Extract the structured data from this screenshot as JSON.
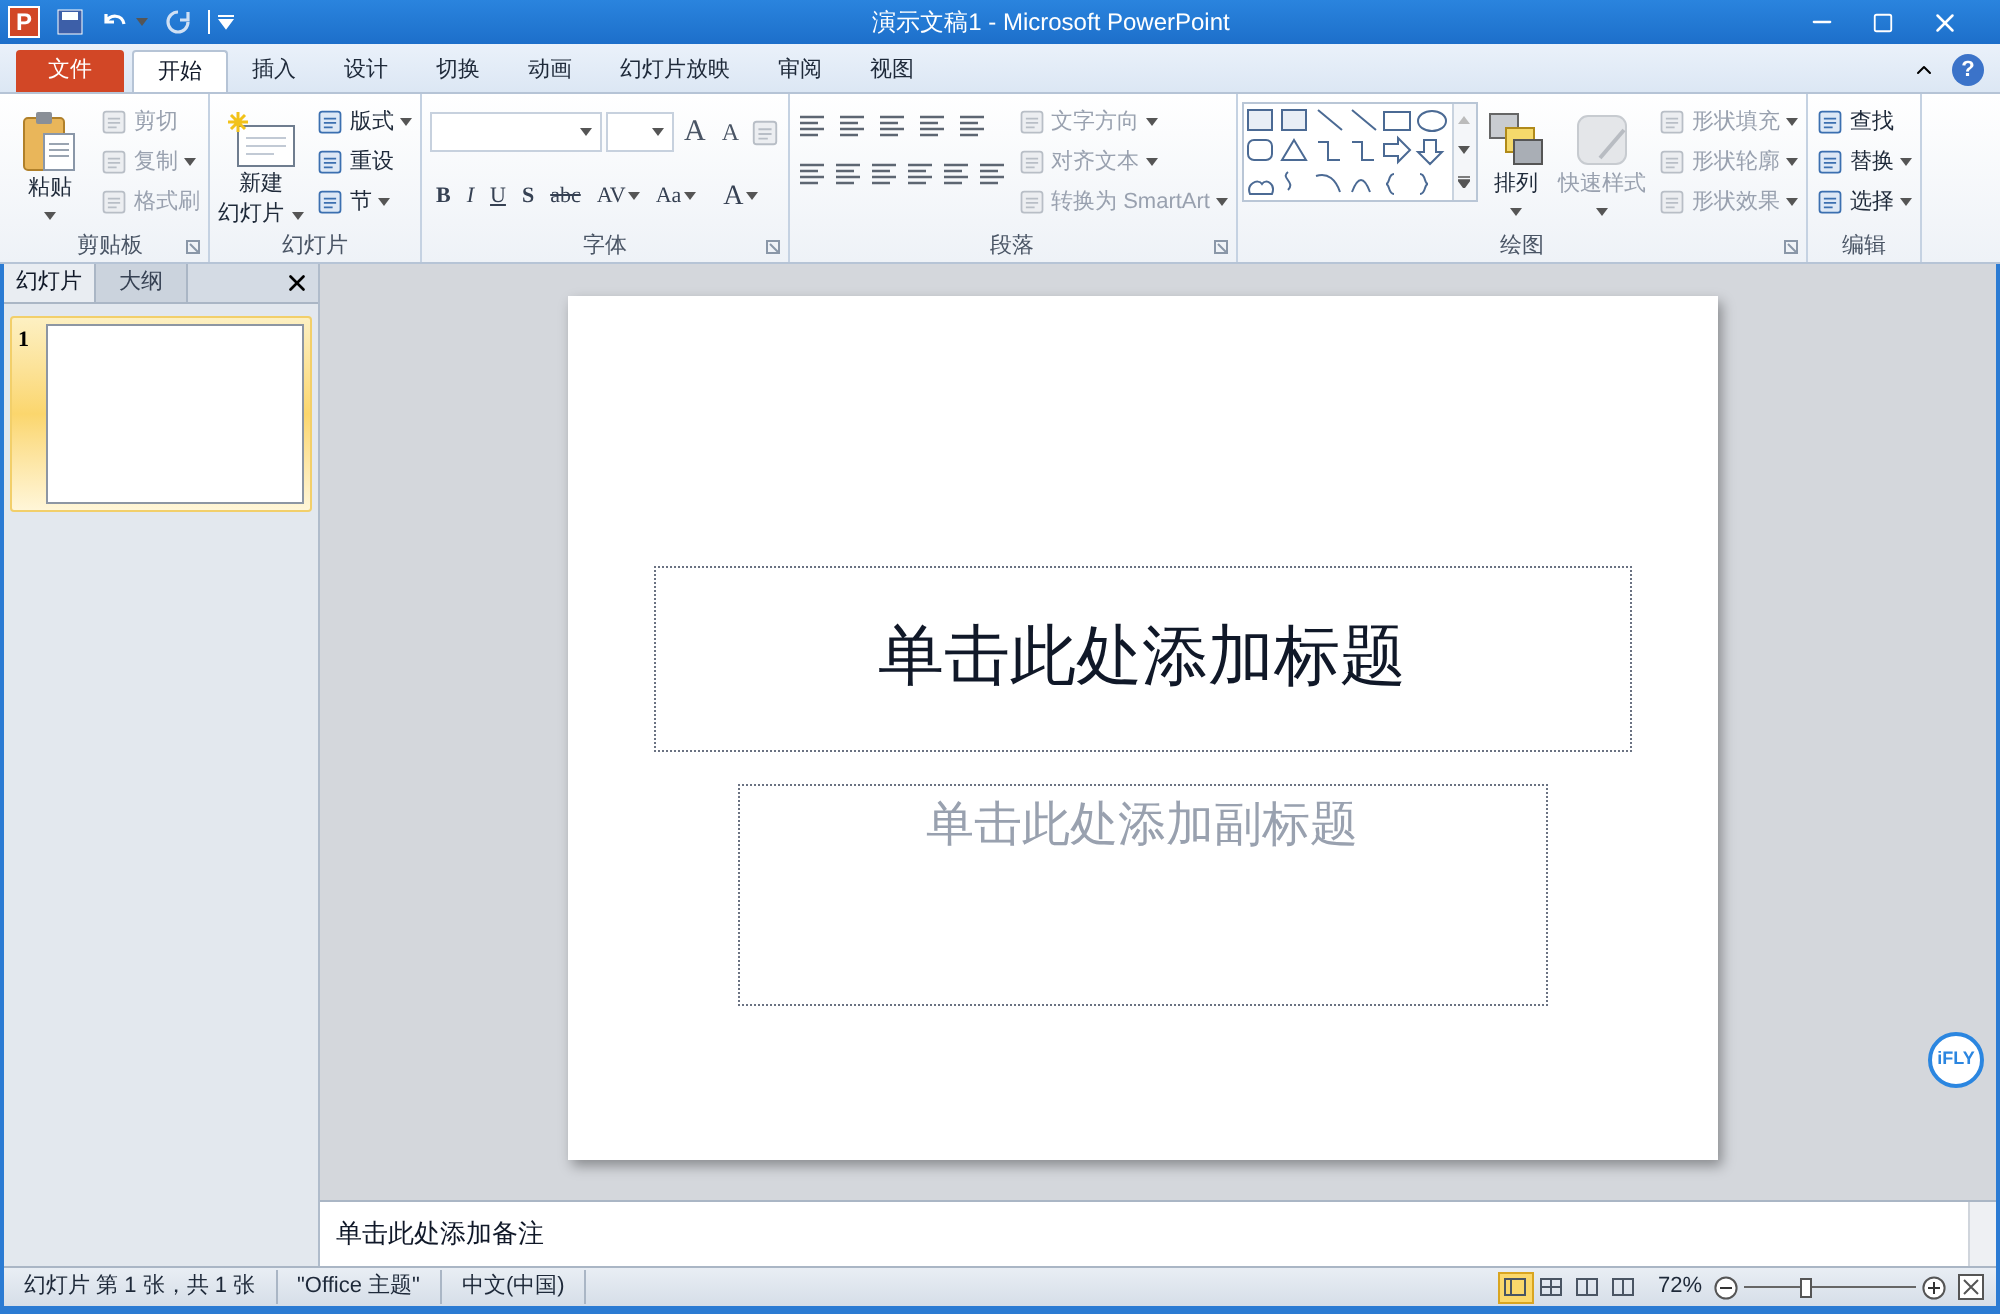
{
  "window": {
    "app_logo": "P",
    "title": "演示文稿1 - Microsoft PowerPoint"
  },
  "tabs": [
    {
      "label": "文件",
      "kind": "file",
      "selected": false
    },
    {
      "label": "开始",
      "kind": "tab",
      "selected": true
    },
    {
      "label": "插入",
      "kind": "tab",
      "selected": false
    },
    {
      "label": "设计",
      "kind": "tab",
      "selected": false
    },
    {
      "label": "切换",
      "kind": "tab",
      "selected": false
    },
    {
      "label": "动画",
      "kind": "tab",
      "selected": false
    },
    {
      "label": "幻灯片放映",
      "kind": "tab",
      "selected": false
    },
    {
      "label": "审阅",
      "kind": "tab",
      "selected": false
    },
    {
      "label": "视图",
      "kind": "tab",
      "selected": false
    }
  ],
  "help": "?",
  "ribbon": {
    "clipboard": {
      "label": "剪贴板",
      "large": {
        "lines": [
          "粘贴"
        ],
        "dropdown": true,
        "disabled": false
      },
      "items": [
        {
          "label": "剪切",
          "dropdown": false,
          "disabled": true
        },
        {
          "label": "复制",
          "dropdown": true,
          "disabled": true
        },
        {
          "label": "格式刷",
          "dropdown": false,
          "disabled": true
        }
      ]
    },
    "slides": {
      "label": "幻灯片",
      "large": {
        "lines": [
          "新建",
          "幻灯片"
        ],
        "dropdown": true,
        "disabled": false
      },
      "items": [
        {
          "label": "版式",
          "dropdown": true,
          "disabled": false
        },
        {
          "label": "重设",
          "dropdown": false,
          "disabled": false
        },
        {
          "label": "节",
          "dropdown": true,
          "disabled": false
        }
      ]
    },
    "font": {
      "label": "字体",
      "size_buttons": [
        {
          "label": "A",
          "kind": "grow"
        },
        {
          "label": "A",
          "kind": "shrink"
        }
      ],
      "format_buttons": [
        {
          "label": "B",
          "kind": "bold",
          "dropdown": false
        },
        {
          "label": "I",
          "kind": "italic",
          "dropdown": false
        },
        {
          "label": "U",
          "kind": "underline",
          "dropdown": false
        },
        {
          "label": "S",
          "kind": "shadow",
          "dropdown": false
        },
        {
          "label": "abc",
          "kind": "strike",
          "dropdown": false
        },
        {
          "label": "AV",
          "kind": "spacing",
          "dropdown": true
        },
        {
          "label": "Aa",
          "kind": "case",
          "dropdown": true
        },
        {
          "label": "A",
          "kind": "color",
          "dropdown": true
        }
      ]
    },
    "paragraph": {
      "label": "段落",
      "items": [
        {
          "label": "文字方向",
          "dropdown": true,
          "disabled": true
        },
        {
          "label": "对齐文本",
          "dropdown": true,
          "disabled": true
        },
        {
          "label": "转换为 SmartArt",
          "dropdown": true,
          "disabled": true
        }
      ]
    },
    "drawing": {
      "label": "绘图",
      "large": [
        {
          "lines": [
            "排列"
          ],
          "dropdown": true,
          "disabled": false
        },
        {
          "lines": [
            "快速样式"
          ],
          "dropdown": true,
          "disabled": true
        }
      ],
      "items": [
        {
          "label": "形状填充",
          "dropdown": true,
          "disabled": true
        },
        {
          "label": "形状轮廓",
          "dropdown": true,
          "disabled": true
        },
        {
          "label": "形状效果",
          "dropdown": true,
          "disabled": true
        }
      ]
    },
    "editing": {
      "label": "编辑",
      "items": [
        {
          "label": "查找",
          "dropdown": false,
          "disabled": false
        },
        {
          "label": "替换",
          "dropdown": true,
          "disabled": false
        },
        {
          "label": "选择",
          "dropdown": true,
          "disabled": false
        }
      ]
    }
  },
  "left_panel": {
    "tabs": [
      {
        "label": "幻灯片",
        "selected": true
      },
      {
        "label": "大纲",
        "selected": false
      }
    ],
    "slides": [
      {
        "number": "1",
        "selected": true
      }
    ]
  },
  "slide": {
    "title_placeholder": "单击此处添加标题",
    "subtitle_placeholder": "单击此处添加副标题"
  },
  "notes": {
    "placeholder": "单击此处添加备注"
  },
  "status_bar": {
    "items": [
      "幻灯片 第 1 张，共 1 张",
      "\"Office 主题\"",
      "中文(中国)"
    ],
    "views": [
      {
        "kind": "normal",
        "selected": true
      },
      {
        "kind": "sorter",
        "selected": false
      },
      {
        "kind": "reading",
        "selected": false
      },
      {
        "kind": "show",
        "selected": false
      }
    ],
    "zoom": "72%",
    "zoom_slider": {
      "level": 0.36
    }
  },
  "ifly_badge": "iFLY"
}
